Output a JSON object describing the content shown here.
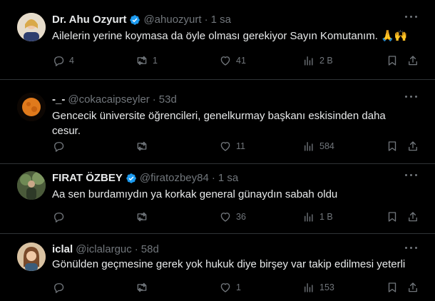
{
  "tweets": [
    {
      "name": "Dr. Ahu Ozyurt",
      "verified": true,
      "handle": "@ahuozyurt",
      "time": "1 sa",
      "text": "Ailelerin yerine koymasa da öyle olması gerekiyor Sayın Komutanım. 🙏🙌",
      "replies": "4",
      "retweets": "1",
      "likes": "41",
      "views": "2 B",
      "avatar_color": "#d8c7a6"
    },
    {
      "name": "-_-",
      "verified": false,
      "handle": "@cokacaipseyler",
      "time": "53d",
      "text": "Gencecik üniversite öğrencileri, genelkurmay başkanı eskisinden daha cesur.",
      "replies": "",
      "retweets": "",
      "likes": "11",
      "views": "584",
      "avatar_color": "#e07a1c"
    },
    {
      "name": "FIRAT ÖZBEY",
      "verified": true,
      "handle": "@firatozbey84",
      "time": "1 sa",
      "text": "Aa sen burdamıydın ya korkak general günaydın sabah oldu",
      "replies": "",
      "retweets": "",
      "likes": "36",
      "views": "1 B",
      "avatar_color": "#5b6e4a"
    },
    {
      "name": "iclal",
      "verified": false,
      "handle": "@iclalarguc",
      "time": "58d",
      "text": "Gönülden geçmesine gerek yok hukuk diye birşey var takip edilmesi yeterli",
      "replies": "",
      "retweets": "",
      "likes": "1",
      "views": "153",
      "avatar_color": "#c99a73"
    }
  ],
  "colors": {
    "background": "#000000",
    "text": "#e7e9ea",
    "muted": "#71767b",
    "verified": "#1d9bf0",
    "divider": "#2f3336"
  },
  "icons": [
    "reply-icon",
    "retweet-icon",
    "like-icon",
    "views-icon",
    "bookmark-icon",
    "share-icon",
    "more-icon",
    "verified-icon"
  ]
}
